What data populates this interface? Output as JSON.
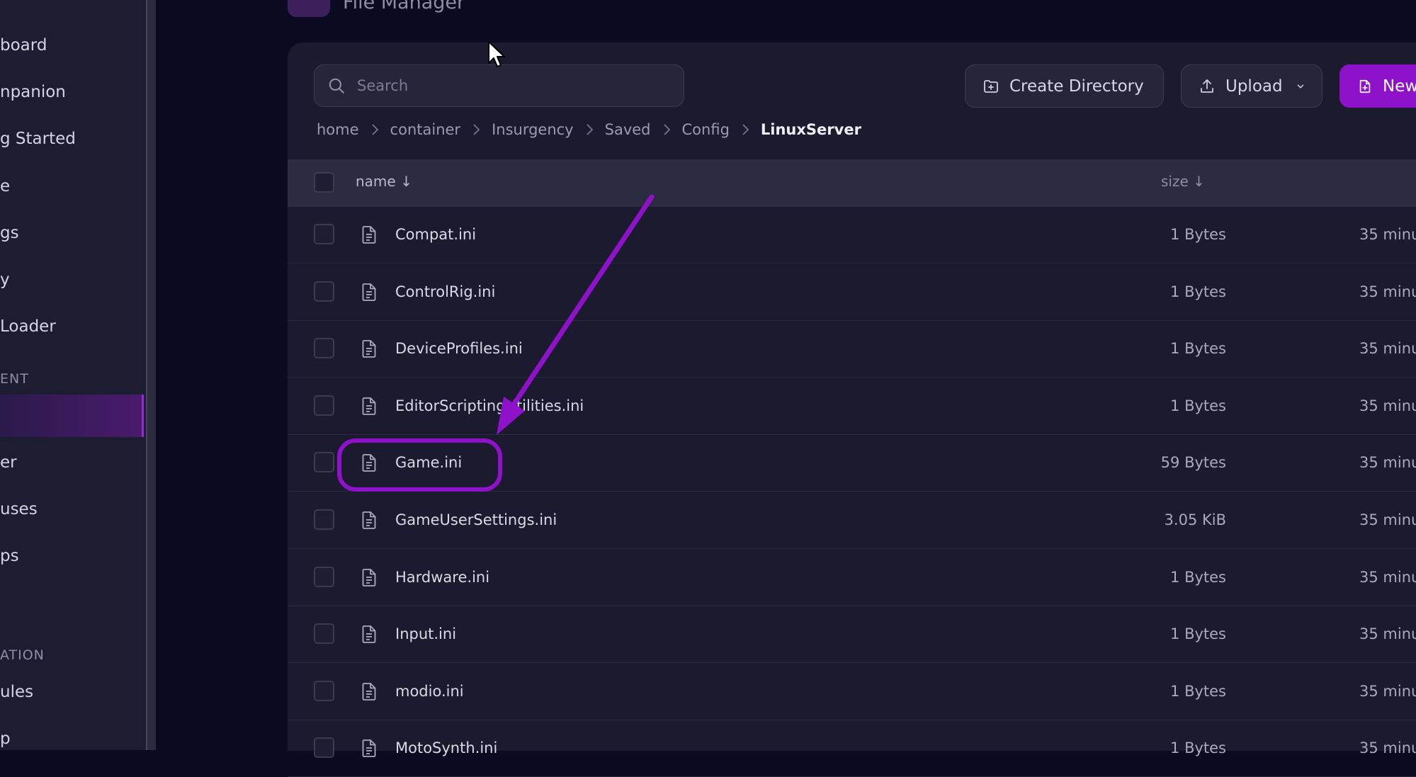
{
  "sidebar": {
    "items": [
      {
        "label": "board"
      },
      {
        "label": "npanion"
      },
      {
        "label": "g Started"
      },
      {
        "label": "e"
      },
      {
        "label": "gs"
      },
      {
        "label": "y"
      },
      {
        "label": " Loader"
      }
    ],
    "section_label": "ENT",
    "items2": [
      {
        "label": ""
      },
      {
        "label": "er"
      },
      {
        "label": "uses"
      },
      {
        "label": "ps"
      }
    ],
    "section_label2": "ATION",
    "items3": [
      {
        "label": "ules"
      },
      {
        "label": "p"
      }
    ]
  },
  "header": {
    "title": "File Manager"
  },
  "search": {
    "placeholder": "Search"
  },
  "toolbar": {
    "create_directory_label": "Create Directory",
    "upload_label": "Upload",
    "new_label": "New"
  },
  "breadcrumb": [
    "home",
    "container",
    "Insurgency",
    "Saved",
    "Config",
    "LinuxServer"
  ],
  "table": {
    "columns": {
      "name": "name ↓",
      "size": "size ↓"
    },
    "rows": [
      {
        "name": "Compat.ini",
        "size": "1 Bytes",
        "modified": "35 minu"
      },
      {
        "name": "ControlRig.ini",
        "size": "1 Bytes",
        "modified": "35 minu"
      },
      {
        "name": "DeviceProfiles.ini",
        "size": "1 Bytes",
        "modified": "35 minu"
      },
      {
        "name": "EditorScriptingUtilities.ini",
        "size": "1 Bytes",
        "modified": "35 minu"
      },
      {
        "name": "Game.ini",
        "size": "59 Bytes",
        "modified": "35 minu"
      },
      {
        "name": "GameUserSettings.ini",
        "size": "3.05 KiB",
        "modified": "35 minu"
      },
      {
        "name": "Hardware.ini",
        "size": "1 Bytes",
        "modified": "35 minu"
      },
      {
        "name": "Input.ini",
        "size": "1 Bytes",
        "modified": "35 minu"
      },
      {
        "name": "modio.ini",
        "size": "1 Bytes",
        "modified": "35 minu"
      },
      {
        "name": "MotoSynth.ini",
        "size": "1 Bytes",
        "modified": "35 minu"
      }
    ]
  },
  "colors": {
    "accent": "#8e12c9",
    "background": "#0b0a20",
    "card": "#1b1a2f",
    "sidebar": "#1d1d32"
  },
  "icons": [
    "search-icon",
    "folder-plus-icon",
    "upload-icon",
    "chevron-down-icon",
    "file-plus-icon",
    "chevron-right-icon",
    "file-icon",
    "cursor-icon"
  ]
}
